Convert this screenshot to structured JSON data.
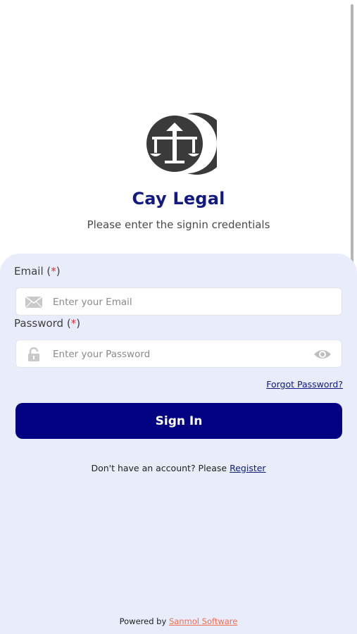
{
  "brand": {
    "title": "Cay Legal",
    "subtitle": "Please enter the signin credentials",
    "logo_icon": "scales-of-justice-icon"
  },
  "form": {
    "email": {
      "label": "Email",
      "required_open": " (",
      "required_mark": "*",
      "required_close": ")",
      "placeholder": "Enter your Email",
      "value": "",
      "icon": "envelope-icon"
    },
    "password": {
      "label": "Password",
      "required_open": " (",
      "required_mark": "*",
      "required_close": ")",
      "placeholder": "Enter your Password",
      "value": "",
      "icon": "lock-icon",
      "toggle_icon": "eye-icon"
    },
    "forgot_label": "Forgot Password?",
    "submit_label": "Sign In"
  },
  "register": {
    "prompt": "Don't have an account? Please ",
    "link": "Register"
  },
  "footer": {
    "prefix": "Powered by ",
    "company": "Sanmol Software"
  },
  "colors": {
    "brand_navy": "#020182",
    "title_blue": "#101a82",
    "panel_bg": "#e8ecfb",
    "required_red": "#d32f2f",
    "footer_link": "#f26d4f"
  }
}
